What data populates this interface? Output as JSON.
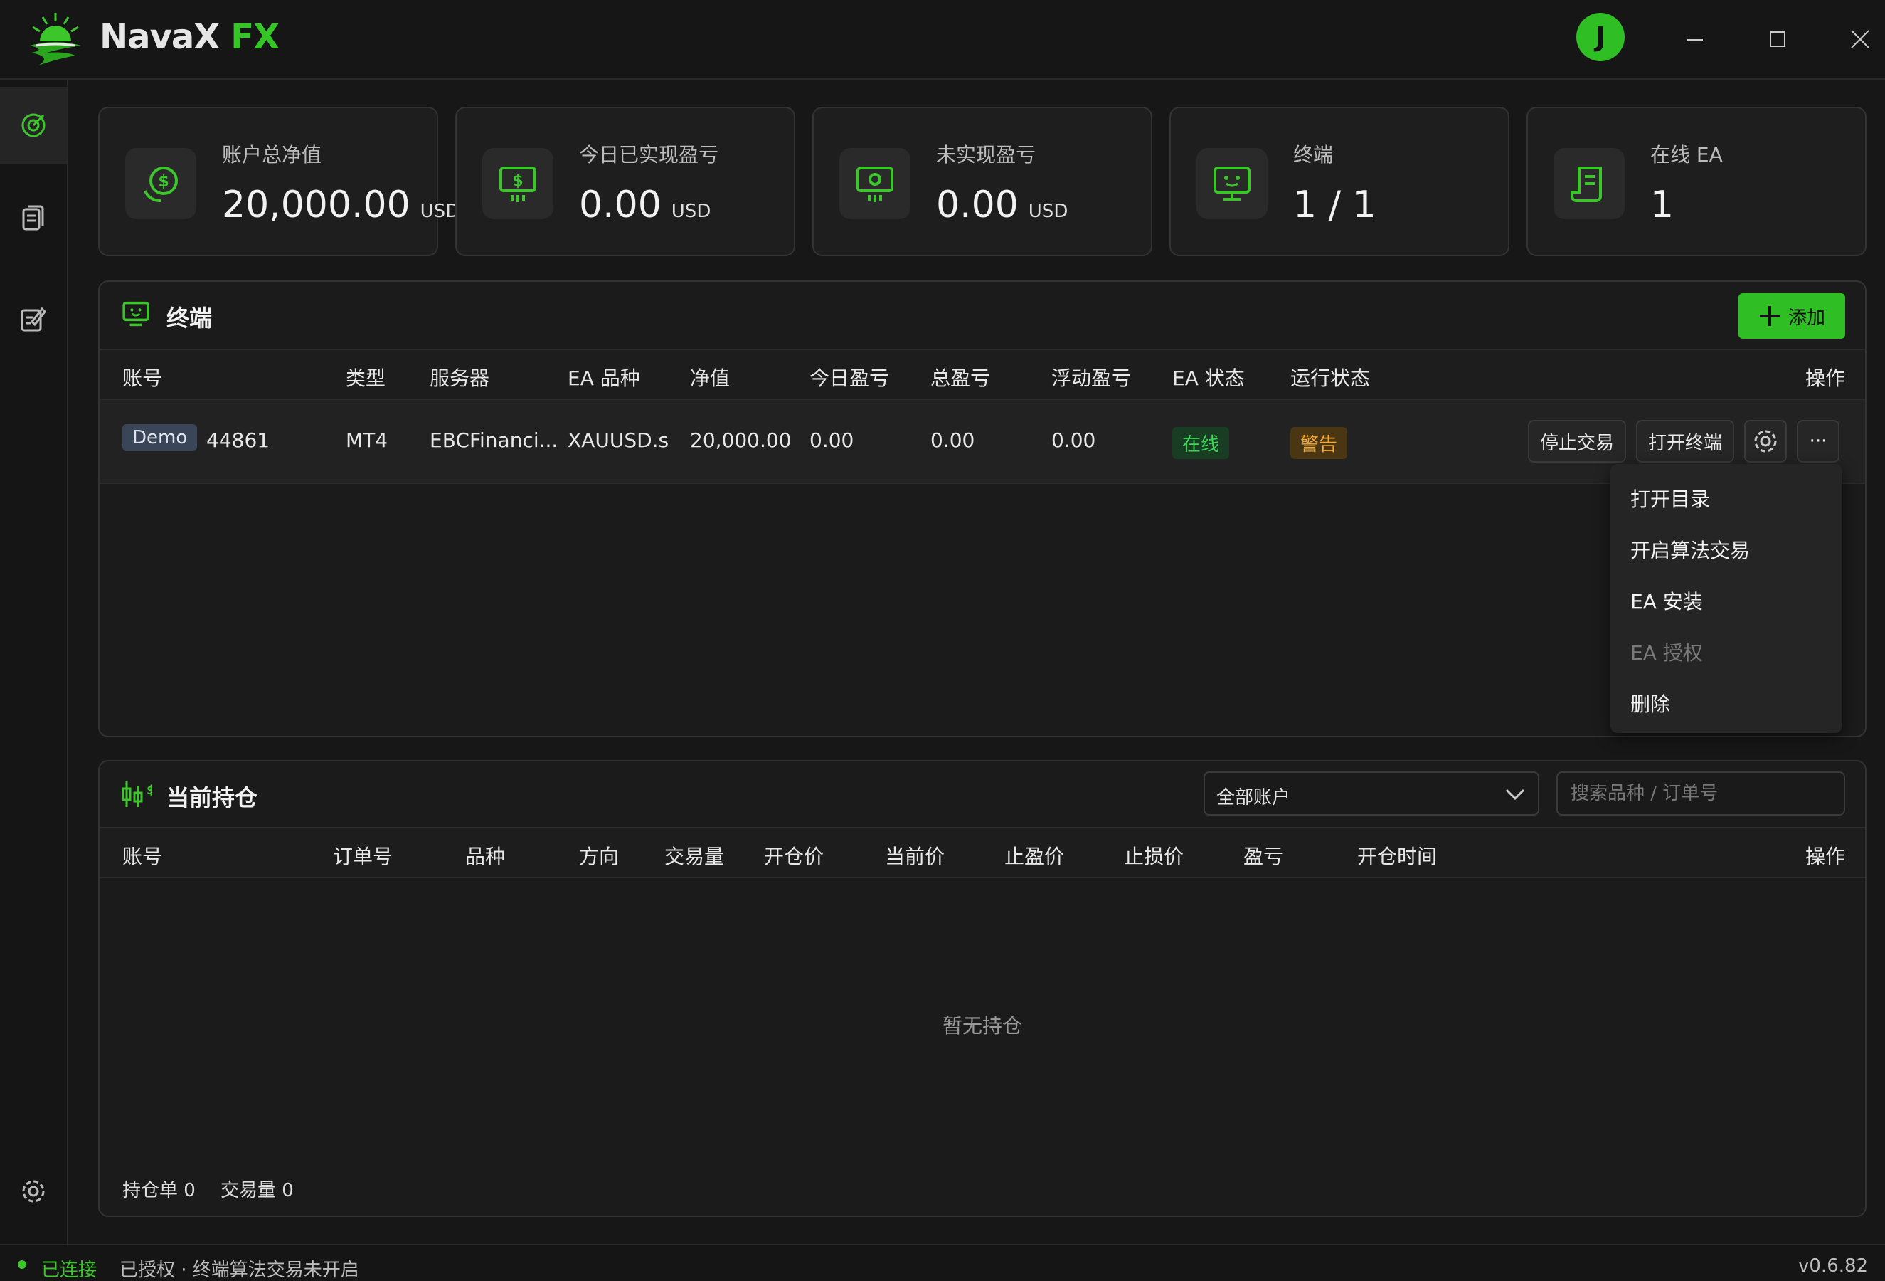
{
  "app": {
    "name": "NavaX",
    "suffix": "FX",
    "avatar": "J",
    "accent": "#2fbf25"
  },
  "window_controls": [
    "minimize-icon",
    "maximize-icon",
    "close-icon"
  ],
  "sidebar": [
    "dashboard-icon",
    "documents-icon",
    "edit-icon",
    "settings-icon"
  ],
  "stats": [
    {
      "label": "账户总净值",
      "value": "20,000.00",
      "unit": "USD",
      "icon": "dollar-icon"
    },
    {
      "label": "今日已实现盈亏",
      "value": "0.00",
      "unit": "USD",
      "icon": "cash-icon"
    },
    {
      "label": "未实现盈亏",
      "value": "0.00",
      "unit": "USD",
      "icon": "money-icon"
    },
    {
      "label": "终端",
      "value": "1 / 1",
      "unit": "",
      "icon": "monitor-icon"
    },
    {
      "label": "在线 EA",
      "value": "1",
      "unit": "",
      "icon": "script-icon"
    }
  ],
  "terminals": {
    "title": "终端",
    "add_label": "添加",
    "columns": [
      "账号",
      "类型",
      "服务器",
      "EA 品种",
      "净值",
      "今日盈亏",
      "总盈亏",
      "浮动盈亏",
      "EA 状态",
      "运行状态",
      "操作"
    ],
    "rows": [
      {
        "badge": "Demo",
        "account": "44861",
        "type": "MT4",
        "server": "EBCFinanci...",
        "symbol": "XAUUSD.s",
        "equity": "20,000.00",
        "today_pl": "0.00",
        "total_pl": "0.00",
        "float_pl": "0.00",
        "ea_status": "在线",
        "run_status": "警告"
      }
    ],
    "actions": {
      "stop": "停止交易",
      "open": "打开终端",
      "more": "···"
    },
    "menu": [
      {
        "label": "打开目录",
        "enabled": true
      },
      {
        "label": "开启算法交易",
        "enabled": true
      },
      {
        "label": "EA 安装",
        "enabled": true
      },
      {
        "label": "EA 授权",
        "enabled": false
      },
      {
        "label": "删除",
        "enabled": true
      }
    ]
  },
  "positions": {
    "title": "当前持仓",
    "filter_value": "全部账户",
    "search_placeholder": "搜索品种 / 订单号",
    "columns": [
      "账号",
      "订单号",
      "品种",
      "方向",
      "交易量",
      "开仓价",
      "当前价",
      "止盈价",
      "止损价",
      "盈亏",
      "开仓时间",
      "操作"
    ],
    "empty_text": "暂无持仓",
    "summary_orders": "持仓单 0",
    "summary_volume": "交易量 0"
  },
  "status": {
    "connected": "已连接",
    "message": "已授权 · 终端算法交易未开启",
    "version": "v0.6.82"
  }
}
